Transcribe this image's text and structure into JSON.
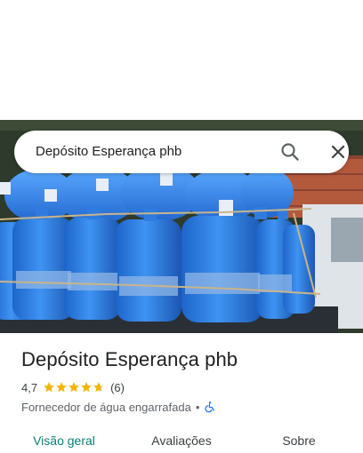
{
  "search": {
    "query": "Depósito Esperança phb",
    "search_icon": "search-icon",
    "close_icon": "close-icon"
  },
  "place": {
    "name": "Depósito Esperança phb",
    "rating": "4,7",
    "stars": 4.7,
    "review_count": "(6)",
    "category": "Fornecedor de água engarrafada",
    "separator": "•",
    "accessibility_icon": "wheelchair-icon"
  },
  "tabs": [
    {
      "label": "Visão geral",
      "active": true
    },
    {
      "label": "Avaliações",
      "active": false
    },
    {
      "label": "Sobre",
      "active": false
    }
  ],
  "colors": {
    "accent": "#0b7d78",
    "star": "#f4b400",
    "accessibility": "#1a73e8"
  }
}
